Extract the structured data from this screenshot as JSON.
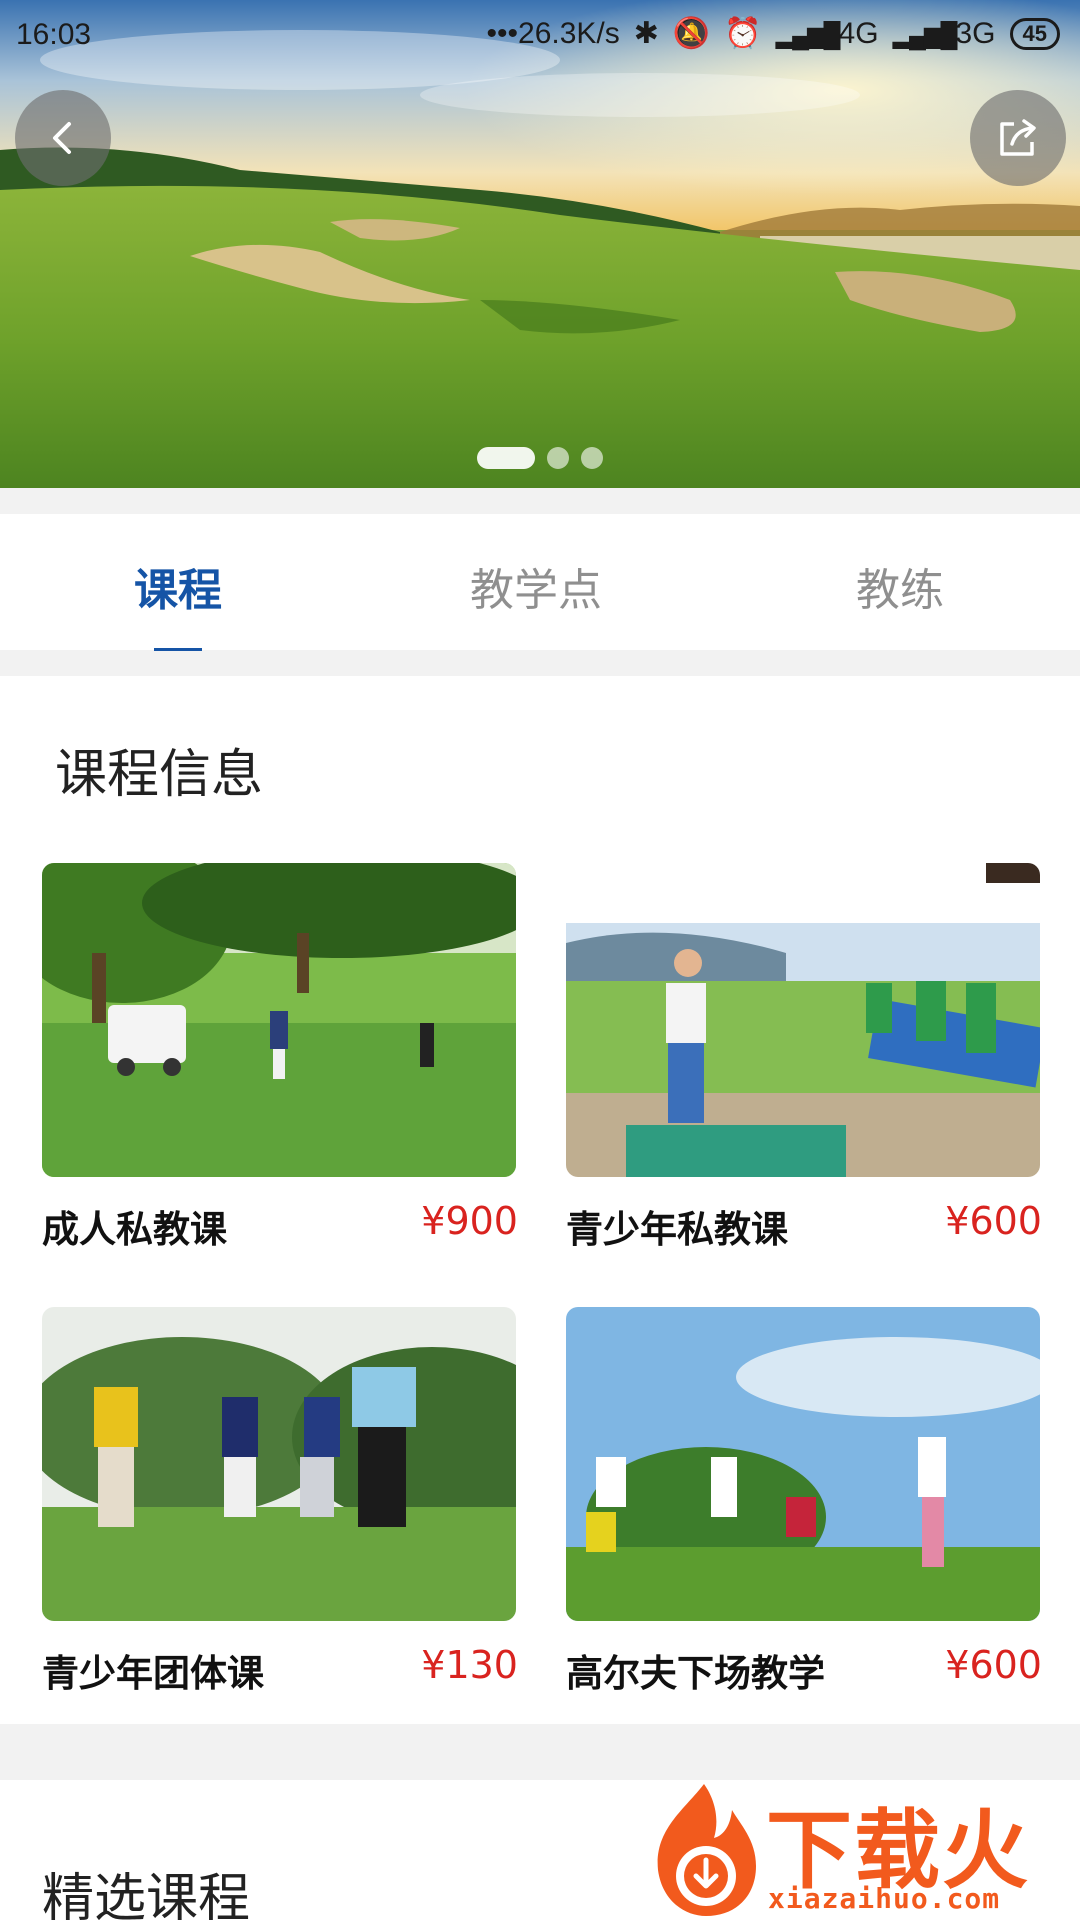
{
  "status_bar": {
    "time": "16:03",
    "network_speed": "26.3K/s",
    "signal_1": "4G",
    "signal_2": "3G",
    "battery": "45"
  },
  "hero": {
    "back_icon": "chevron-left-icon",
    "share_icon": "share-icon",
    "carousel_total": 3,
    "carousel_active_index": 0
  },
  "tabs": [
    {
      "label": "课程",
      "active": true
    },
    {
      "label": "教学点",
      "active": false
    },
    {
      "label": "教练",
      "active": false
    }
  ],
  "course_info": {
    "title": "课程信息",
    "courses": [
      {
        "name": "成人私教课",
        "price": "¥900"
      },
      {
        "name": "青少年私教课",
        "price": "¥600"
      },
      {
        "name": "青少年团体课",
        "price": "¥130"
      },
      {
        "name": "高尔夫下场教学",
        "price": "¥600"
      }
    ]
  },
  "featured": {
    "title": "精选课程"
  },
  "watermark": {
    "brand": "下载火",
    "url": "xiazaihuo.com"
  },
  "colors": {
    "accent": "#1554a6",
    "price": "#d9231f",
    "watermark": "#f25a1d"
  }
}
